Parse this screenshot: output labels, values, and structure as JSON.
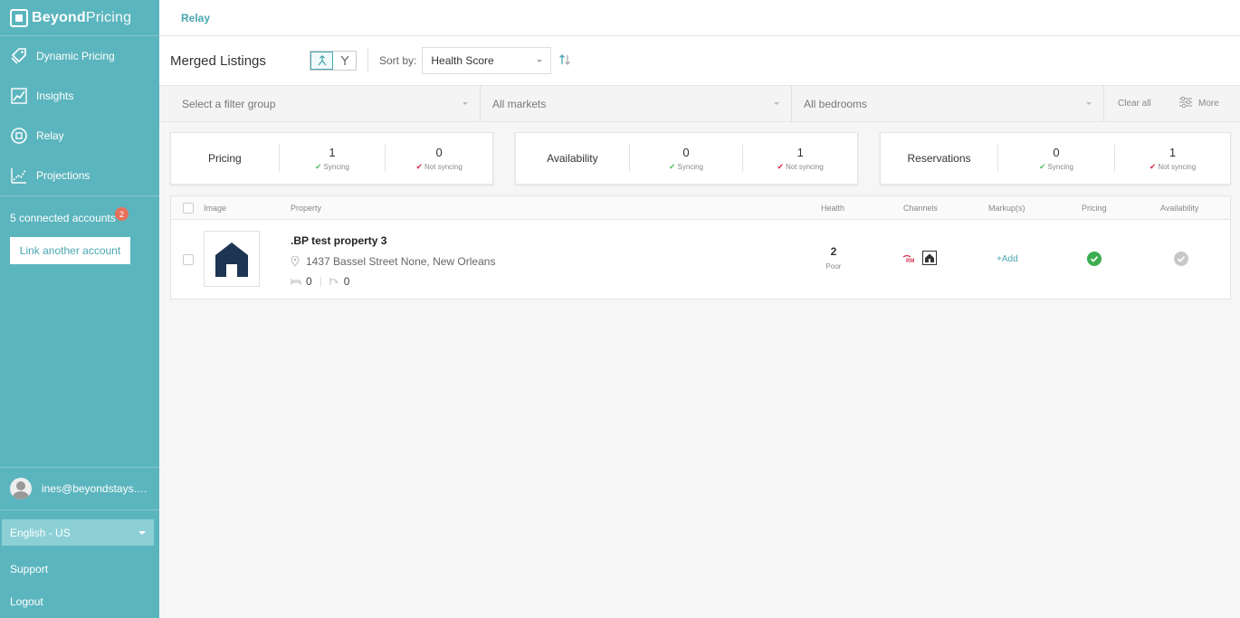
{
  "brand": {
    "strong": "Beyond",
    "light": "Pricing"
  },
  "nav": [
    {
      "label": "Dynamic Pricing",
      "icon": "tag-icon"
    },
    {
      "label": "Insights",
      "icon": "chart-icon"
    },
    {
      "label": "Relay",
      "icon": "relay-icon"
    },
    {
      "label": "Projections",
      "icon": "projection-icon"
    }
  ],
  "accounts": {
    "label": "5 connected accounts",
    "badge": "2",
    "link_button": "Link another account"
  },
  "user": {
    "email": "ines@beyondstays.…"
  },
  "language": {
    "selected": "English - US"
  },
  "footer": {
    "support": "Support",
    "logout": "Logout"
  },
  "breadcrumb": "Relay",
  "toolbar": {
    "title": "Merged Listings",
    "sort_label": "Sort by:",
    "sort_value": "Health Score"
  },
  "filters": {
    "group_placeholder": "Select a filter group",
    "markets": "All markets",
    "bedrooms": "All bedrooms",
    "clear_all": "Clear all",
    "more": "More"
  },
  "stats": [
    {
      "label": "Pricing",
      "syncing": "1",
      "not_syncing": "0"
    },
    {
      "label": "Availability",
      "syncing": "0",
      "not_syncing": "1"
    },
    {
      "label": "Reservations",
      "syncing": "0",
      "not_syncing": "1"
    }
  ],
  "stat_text": {
    "syncing": "Syncing",
    "not_syncing": "Not syncing"
  },
  "table": {
    "headers": {
      "image": "Image",
      "property": "Property",
      "health": "Health",
      "channels": "Channels",
      "markups": "Markup(s)",
      "pricing": "Pricing",
      "availability": "Availability"
    },
    "rows": [
      {
        "name": ".BP test property 3",
        "address": "1437 Bassel Street None, New Orleans",
        "bedrooms": "0",
        "bathrooms": "0",
        "health_score": "2",
        "health_label": "Poor",
        "markup": "+Add"
      }
    ]
  },
  "colors": {
    "sidebar": "#5bb5be",
    "accent": "#4aa6b0",
    "badge": "#e8705a",
    "success": "#3cad4f",
    "error": "#d9324f"
  }
}
